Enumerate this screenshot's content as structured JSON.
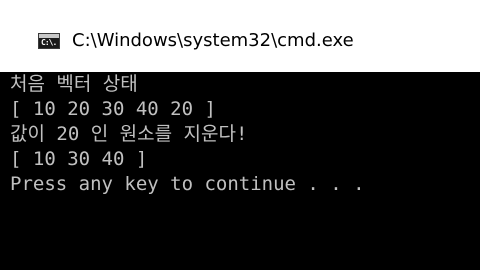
{
  "window": {
    "title": "C:\\Windows\\system32\\cmd.exe",
    "icon": "cmd-icon",
    "icon_glyph": "C:\\."
  },
  "console": {
    "lines": [
      "처음 벡터 상태",
      "[ 10 20 30 40 20 ]",
      "값이 20 인 원소를 지운다!",
      "[ 10 30 40 ]",
      "Press any key to continue . . ."
    ],
    "foreground_color": "#c0c0c0",
    "background_color": "#000000"
  }
}
